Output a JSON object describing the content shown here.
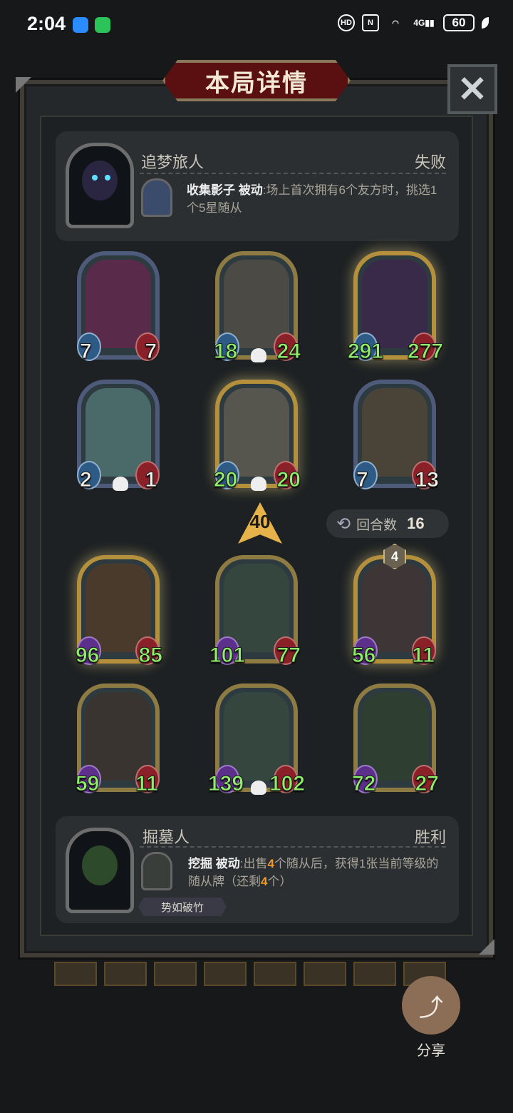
{
  "status_bar": {
    "time": "2:04",
    "battery": "60",
    "network": "4G"
  },
  "dialog": {
    "title": "本局详情",
    "close": "✕"
  },
  "player_top": {
    "name": "追梦旅人",
    "result": "失败",
    "skill_name": "收集影子",
    "skill_type": "被动",
    "skill_desc": ":场上首次拥有6个友方时，挑选1个5星随从"
  },
  "top_board": [
    {
      "atk": "7",
      "hp": "7"
    },
    {
      "atk": "18",
      "hp": "24"
    },
    {
      "atk": "291",
      "hp": "277"
    },
    {
      "atk": "2",
      "hp": "1"
    },
    {
      "atk": "20",
      "hp": "20"
    },
    {
      "atk": "7",
      "hp": "13"
    }
  ],
  "turn": {
    "value": "40",
    "round_label": "回合数",
    "round_value": "16"
  },
  "bottom_board": [
    {
      "atk": "96",
      "hp": "85"
    },
    {
      "atk": "101",
      "hp": "77"
    },
    {
      "atk": "56",
      "hp": "11",
      "tier": "4"
    },
    {
      "atk": "59",
      "hp": "11"
    },
    {
      "atk": "139",
      "hp": "102"
    },
    {
      "atk": "72",
      "hp": "27"
    }
  ],
  "player_bottom": {
    "name": "掘墓人",
    "result": "胜利",
    "skill_name": "挖掘",
    "skill_type": "被动",
    "skill_desc_1": ":出售",
    "skill_num_1": "4",
    "skill_desc_2": "个随从后，获得1张当前等级的随从牌（还剩",
    "skill_num_2": "4",
    "skill_desc_3": "个）",
    "tag": "势如破竹"
  },
  "share": {
    "label": "分享"
  }
}
